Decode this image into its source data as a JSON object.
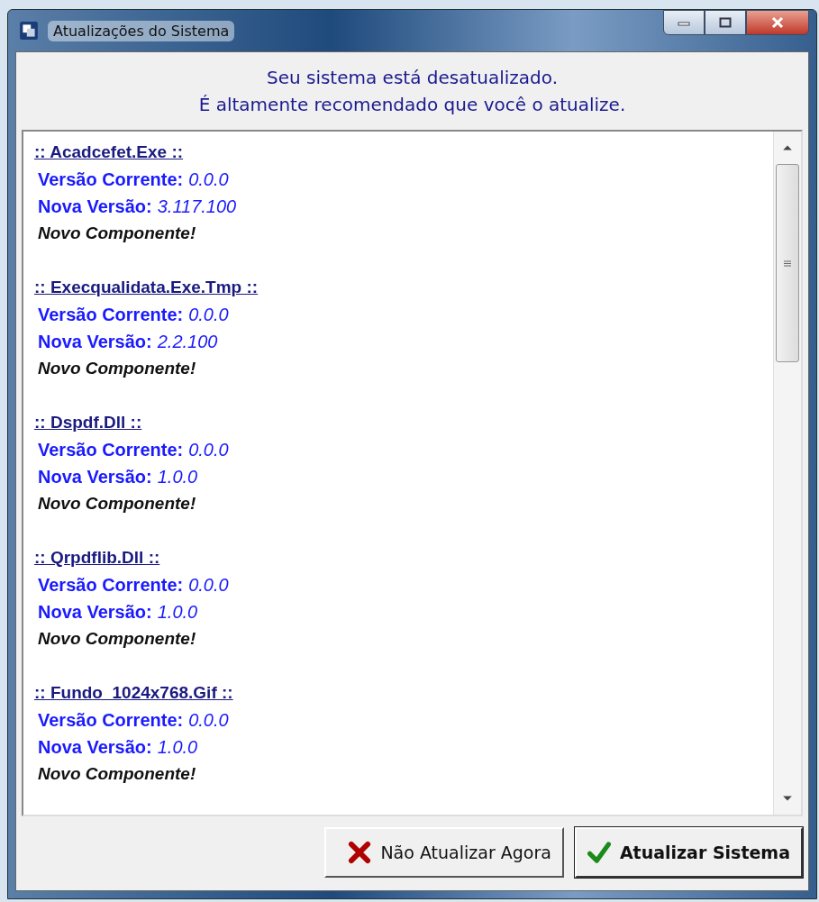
{
  "window": {
    "title": "Atualizações do Sistema"
  },
  "header": {
    "lines": [
      "Seu sistema está desatualizado.",
      "É altamente recomendado que você o atualize."
    ]
  },
  "components": [
    {
      "title": ":: Acadcefet.Exe ::",
      "current_label": "Versão Corrente:",
      "current_value": "0.0.0",
      "new_label": "Nova Versão:",
      "new_value": "3.117.100",
      "note": "Novo Componente!"
    },
    {
      "title": ":: Execqualidata.Exe.Tmp ::",
      "current_label": "Versão Corrente:",
      "current_value": "0.0.0",
      "new_label": "Nova Versão:",
      "new_value": "2.2.100",
      "note": "Novo Componente!"
    },
    {
      "title": ":: Dspdf.Dll ::",
      "current_label": "Versão Corrente:",
      "current_value": "0.0.0",
      "new_label": "Nova Versão:",
      "new_value": "1.0.0",
      "note": "Novo Componente!"
    },
    {
      "title": ":: Qrpdflib.Dll ::",
      "current_label": "Versão Corrente:",
      "current_value": "0.0.0",
      "new_label": "Nova Versão:",
      "new_value": "1.0.0",
      "note": "Novo Componente!"
    },
    {
      "title": ":: Fundo_1024x768.Gif ::",
      "current_label": "Versão Corrente:",
      "current_value": "0.0.0",
      "new_label": "Nova Versão:",
      "new_value": "1.0.0",
      "note": "Novo Componente!"
    }
  ],
  "buttons": [
    {
      "kind": "cancel",
      "label": "Não Atualizar Agora"
    },
    {
      "kind": "confirm",
      "label": "Atualizar Sistema"
    }
  ]
}
